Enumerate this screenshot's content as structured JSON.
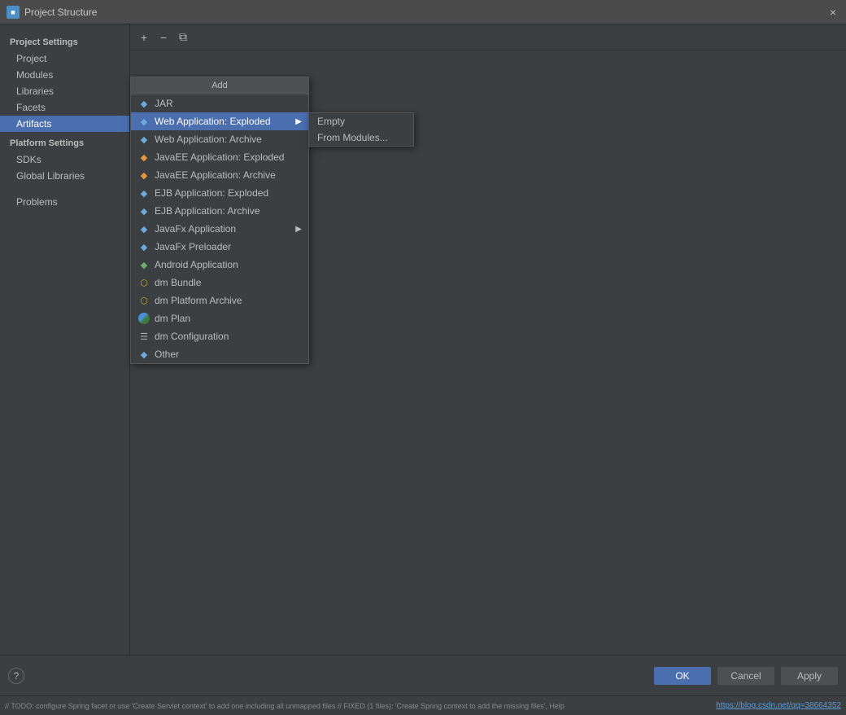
{
  "titleBar": {
    "title": "Project Structure",
    "closeLabel": "×"
  },
  "sidebar": {
    "projectSettingsLabel": "Project Settings",
    "items": [
      {
        "label": "Project",
        "id": "project"
      },
      {
        "label": "Modules",
        "id": "modules"
      },
      {
        "label": "Libraries",
        "id": "libraries"
      },
      {
        "label": "Facets",
        "id": "facets"
      },
      {
        "label": "Artifacts",
        "id": "artifacts",
        "active": true
      }
    ],
    "platformSettingsLabel": "Platform Settings",
    "platformItems": [
      {
        "label": "SDKs",
        "id": "sdks"
      },
      {
        "label": "Global Libraries",
        "id": "global-libraries"
      }
    ],
    "otherItems": [
      {
        "label": "Problems",
        "id": "problems"
      }
    ]
  },
  "toolbar": {
    "addLabel": "+",
    "removeLabel": "−",
    "copyLabel": "⧉"
  },
  "dropdown": {
    "header": "Add",
    "items": [
      {
        "label": "JAR",
        "hasSubmenu": false,
        "iconType": "diamond"
      },
      {
        "label": "Web Application: Exploded",
        "hasSubmenu": true,
        "iconType": "diamond",
        "selected": true
      },
      {
        "label": "Web Application: Archive",
        "hasSubmenu": false,
        "iconType": "diamond"
      },
      {
        "label": "JavaEE Application: Exploded",
        "hasSubmenu": false,
        "iconType": "diamond"
      },
      {
        "label": "JavaEE Application: Archive",
        "hasSubmenu": false,
        "iconType": "diamond"
      },
      {
        "label": "EJB Application: Exploded",
        "hasSubmenu": false,
        "iconType": "diamond"
      },
      {
        "label": "EJB Application: Archive",
        "hasSubmenu": false,
        "iconType": "diamond"
      },
      {
        "label": "JavaFx Application",
        "hasSubmenu": true,
        "iconType": "diamond"
      },
      {
        "label": "JavaFx Preloader",
        "hasSubmenu": false,
        "iconType": "diamond"
      },
      {
        "label": "Android Application",
        "hasSubmenu": false,
        "iconType": "diamond"
      },
      {
        "label": "dm Bundle",
        "hasSubmenu": false,
        "iconType": "circle-special"
      },
      {
        "label": "dm Platform Archive",
        "hasSubmenu": false,
        "iconType": "circle-special"
      },
      {
        "label": "dm Plan",
        "hasSubmenu": false,
        "iconType": "earth"
      },
      {
        "label": "dm Configuration",
        "hasSubmenu": false,
        "iconType": "doc"
      },
      {
        "label": "Other",
        "hasSubmenu": false,
        "iconType": "diamond"
      }
    ]
  },
  "submenu": {
    "items": [
      {
        "label": "Empty",
        "active": false
      },
      {
        "label": "From Modules...",
        "active": false
      }
    ]
  },
  "bottomButtons": {
    "ok": "OK",
    "cancel": "Cancel",
    "apply": "Apply"
  },
  "statusBar": {
    "leftText": "// TODO: configure Spring facet or use 'Create Servlet context' to add one including all unmapped files // FIXED (1 files): 'Create Spring context to add the missing files', Help",
    "rightLink": "https://blog.csdn.net/qq=38664352"
  }
}
